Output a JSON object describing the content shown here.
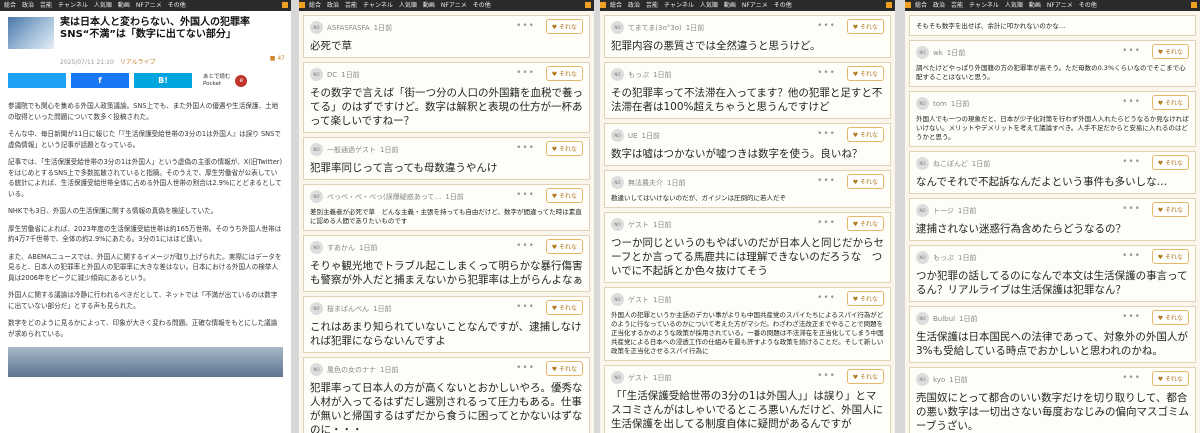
{
  "nav": {
    "items": [
      "総合",
      "政治",
      "芸能",
      "チャンネル",
      "人気順",
      "動画",
      "NFアニメ",
      "その他"
    ]
  },
  "article": {
    "title": "実は日本人と変わらない、外国人の犯罪率　SNS“不満”は「数字に出てない部分」",
    "date": "2025/07/11 21:10",
    "source": "リアルライブ",
    "comment_count": "47",
    "share": {
      "twitter": "",
      "facebook": "f",
      "hatena": "B!"
    },
    "read_later": "あとで読む",
    "read_later_service": "Pocket",
    "paragraphs": [
      "参議院でも関心を集める外国人政策議論。SNS上でも、また外国人の優遇や生活保護、土地の取得といった問題について数多く投稿された。",
      "そんな中、毎日新聞が11日に報じた「『生活保護受給世帯の3分の1は外国人』は誤り SNSで虚偽情報」という記事が話題となっている。",
      "記事では、「生活保護受給世帯の3分の1は外国人」という虚偽の主張の情報が、X(旧Twitter)をはじめとするSNS上で多数拡散されていると指摘。そのうえで、厚生労働省が公表している統計によれば、生活保護受給世帯全体に占める外国人世帯の割合は2.9%にとどまるとしている。",
      "NHKでも3日、外国人の生活保護に関する情報の真偽を検証していた。",
      "厚生労働省によれば、2023年度の生活保護受給世帯は約165万世帯。そのうち外国人世帯は約4万7千世帯で、全体の約2.9%にあたる。3分の1にはほど遠い。",
      "また、ABEMAニュースでは、外国人に関するイメージが取り上げられた。実際にはデータを見ると、日本人の犯罪率と外国人の犯罪率に大きな差はない。日本における外国人の検挙人員は2006年をピークに減少傾向にあるという。",
      "外国人に関する議論は冷静に行われるべきだとして、ネットでは「不満が出ているのは数字に出ていない部分だ」とする声も見られた。",
      "数字をどのように見るかによって、印象が大きく変わる問題。正確な情報をもとにした議論が求められている。"
    ]
  },
  "sorena_label": "それな",
  "columns": [
    {
      "comments": [
        {
          "user": "ASFASFASFA",
          "time": "1日前",
          "text": "必死で草",
          "small": false
        },
        {
          "user": "DC",
          "time": "1日前",
          "text": "その数字で言えば「街一つ分の人口の外国籍を血税で養ってる」のはずですけど。数字は解釈と表現の仕方が一杯あって楽しいですねー？",
          "small": false
        },
        {
          "user": "一般通過ゲスト",
          "time": "1日前",
          "text": "犯罪率同じって言っても母数違うやんけ",
          "small": false
        },
        {
          "user": "ぺっぺ・ぺ・ぺっ(誤爆疑惑あって…",
          "time": "1日前",
          "text": "差別主義者が必死で草　どんな主義・主張を持っても自由だけど、数字が間違ってた時は素直に認める人間でありたいものです",
          "small": true
        },
        {
          "user": "すあかん",
          "time": "1日前",
          "text": "そりゃ観光地でトラブル起こしまくって明らかな暴行傷害も警察が外人だと捕まえないから犯罪率は上がらんよなぁ",
          "small": false
        },
        {
          "user": "桜まばんべん",
          "time": "1日前",
          "text": "これはあまり知られていないことなんですが、逮捕しなければ犯罪にならないんですよ",
          "small": false
        },
        {
          "user": "風色の女のナナ",
          "time": "1日前",
          "text": "犯罪率って日本人の方が高くないとおかしいやろ。優秀な人材が入ってるはずだし選別されるって圧力もある。仕事が無いと帰国するはずだから食うに困ってとかないはずなのに・・・",
          "small": false
        }
      ]
    },
    {
      "comments": [
        {
          "user": "てまてま(3ο°3ο)",
          "time": "1日前",
          "text": "犯罪内容の悪質さでは全然違うと思うけど。",
          "small": false
        },
        {
          "user": "もっぷ",
          "time": "1日前",
          "text": "その犯罪率って不法滞在入ってます？他の犯罪と足すと不法滞在者は100%超えちゃうと思うんですけど",
          "small": false
        },
        {
          "user": "UE",
          "time": "1日前",
          "text": "数字は嘘はつかないが嘘つきは数字を使う。良いね？",
          "small": false
        },
        {
          "user": "無法農夫介",
          "time": "1日前",
          "text": "勘違いしてはいけないのだが、ガイジンは圧倒的に若人だぞ",
          "small": true
        },
        {
          "user": "ゲスト",
          "time": "1日前",
          "text": "つーか同じというのもやばいのだが日本人と同じだからセーフとか言ってる馬鹿共には理解できないのだろうな　ついでに不起訴とか色々抜けてそう",
          "small": false
        },
        {
          "user": "ゲスト",
          "time": "1日前",
          "text": "外国人の犯罪というか主語のデカい事がよりも中国共産党のスパイたちによるスパイ行為がどのように行なっているのかについて考えた方がマシだ。わざわざ法改正までやることで問題を正当化するかのような政策が採用されている。一番の問題は不法滞在を正当化してしまう中国共産党による日本への浸透工作の仕組みを最も許すような政策を続けることだ。そして新しい政策を正当化させるスパイ行為に",
          "small": true
        },
        {
          "user": "ゲスト",
          "time": "1日前",
          "text": "「「生活保護受給世帯の3分の1は外国人」」は誤り」とマスコミさんがはしゃいでるところ悪いんだけど、外国人に生活保護を出してる制度自体に疑問があるんですが",
          "small": false
        }
      ]
    },
    {
      "comments": [
        {
          "user": "",
          "time": "",
          "text": "そもそも数字を出せば、余計に叩かれないのかな…",
          "small": true
        },
        {
          "user": "wk",
          "time": "1日前",
          "text": "調べたけどやっぱり外国籍の方の犯罪率が高そう。ただ母数の0.3%くらいなのでそこまで心配することはないと思う。",
          "small": true
        },
        {
          "user": "tom",
          "time": "1日前",
          "text": "外国人でも一つの現象だと、日本が少子化対策を行わず外国人入れたらどうなるか見なければいけない。メリットやデメリットを考えて議論すべき。人手不足だからと安易に入れるのはどうかと思う。",
          "small": true
        },
        {
          "user": "ねこぽんど",
          "time": "1日前",
          "text": "なんでそれで不起訴なんだよという事件も多いしな…",
          "small": false
        },
        {
          "user": "トージ",
          "time": "1日前",
          "text": "逮捕されない迷惑行為含めたらどうなるの？",
          "small": false
        },
        {
          "user": "もっぷ",
          "time": "1日前",
          "text": "つか犯罪の話してるのになんで本文は生活保護の事言ってるん？リアルライブは生活保護は犯罪なん？",
          "small": false
        },
        {
          "user": "Bulbul",
          "time": "1日前",
          "text": "生活保護は日本国民への法律であって、対象外の外国人が3%も受給している時点でおかしいと思われのかね。",
          "small": false
        },
        {
          "user": "kyo",
          "time": "1日前",
          "text": "売国奴にとって都合のいい数字だけを切り取りして、都合の悪い数字は一切出さない毎度おなじみの偏向マスゴミムーブうざい。",
          "small": false
        }
      ]
    }
  ]
}
